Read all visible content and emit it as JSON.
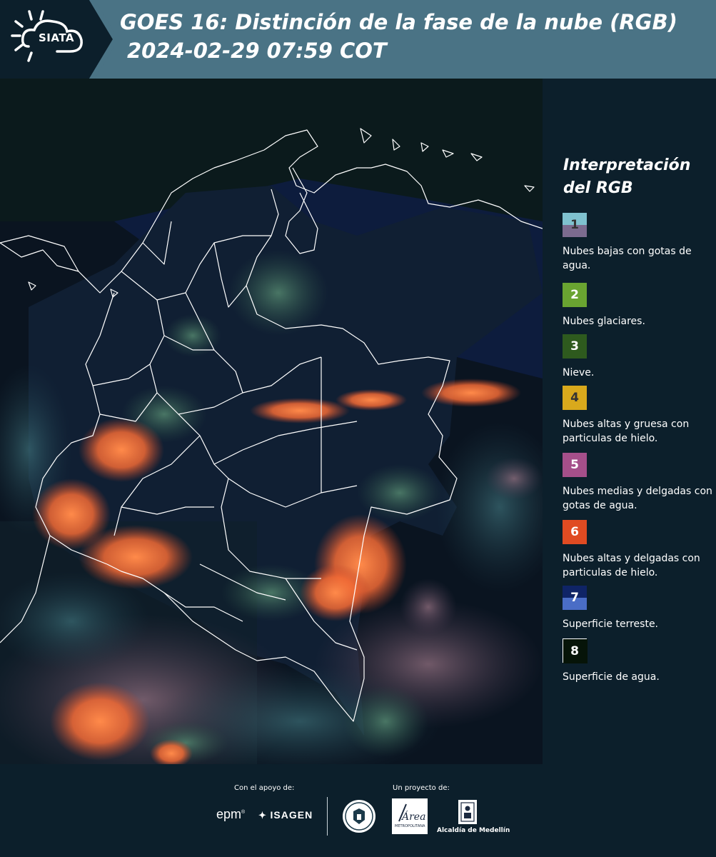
{
  "header": {
    "logo_text": "SIATA",
    "title": "GOES 16: Distinción de la fase de la nube (RGB)",
    "subtitle": "2024-02-29 07:59 COT",
    "background_color": "#4a7385"
  },
  "map": {
    "content": "satellite-rgb-composite",
    "palette": {
      "ocean": "#0c1a33",
      "land": "#0e1b2c",
      "low_clouds": "#3a6a5a",
      "ice_clouds": "#f06a3a",
      "borders": "#ffffff"
    }
  },
  "legend": {
    "title_line1": "Interpretación",
    "title_line2": "del RGB",
    "items": [
      {
        "number": "1",
        "description": "Nubes bajas con gotas de agua.",
        "color_top": "#7fc1cf",
        "color_bottom": "#7c6b8f",
        "text_color": "#333333"
      },
      {
        "number": "2",
        "description": "Nubes glaciares.",
        "color_top": "#6aa431",
        "color_bottom": "#6aa431",
        "text_color": "#ffffff"
      },
      {
        "number": "3",
        "description": "Nieve.",
        "color_top": "#2e5a1e",
        "color_bottom": "#2e5a1e",
        "text_color": "#ffffff"
      },
      {
        "number": "4",
        "description": "Nubes altas y gruesa con particulas de hielo.",
        "color_top": "#d9a91c",
        "color_bottom": "#d9a91c",
        "text_color": "#333333"
      },
      {
        "number": "5",
        "description": "Nubes medias y delgadas con gotas de agua.",
        "color_top": "#a54f8a",
        "color_bottom": "#a54f8a",
        "text_color": "#ffffff"
      },
      {
        "number": "6",
        "description": "Nubes altas y delgadas con particulas de hielo.",
        "color_top": "#e04b22",
        "color_bottom": "#e04b22",
        "text_color": "#ffffff"
      },
      {
        "number": "7",
        "description": "Superficie terreste.",
        "color_top": "#0f2466",
        "color_bottom": "#4a6dc6",
        "text_color": "#ffffff"
      },
      {
        "number": "8",
        "description": "Superficie de agua.",
        "color_top": "#061408",
        "color_bottom": "#061408",
        "text_color": "#ffffff"
      }
    ]
  },
  "footer": {
    "support_label": "Con el apoyo de:",
    "project_label": "Un proyecto de:",
    "epm": "epm",
    "isagen": "ISAGEN",
    "area_metropolitana": "Área",
    "area_metropolitana_sub": "METROPOLITANA",
    "medellin": "Alcaldía de Medellín"
  }
}
